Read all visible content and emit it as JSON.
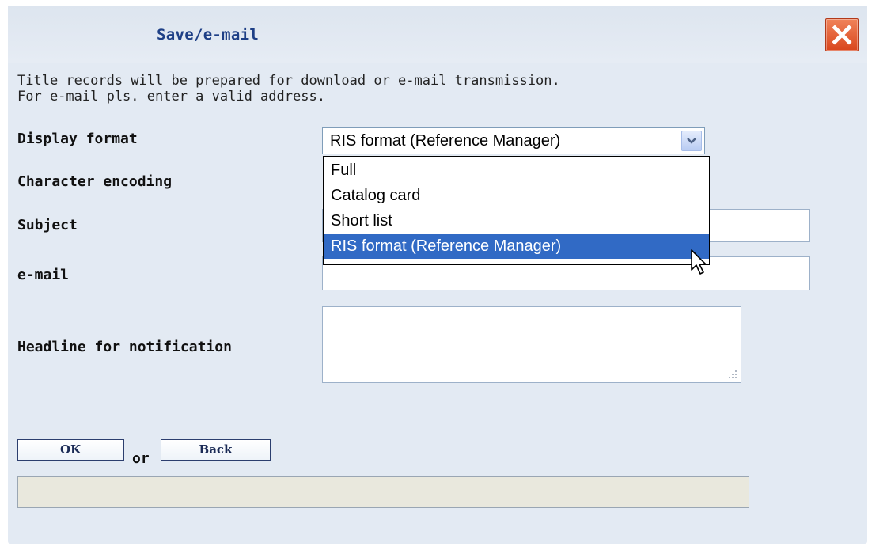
{
  "dialog": {
    "title": "Save/e-mail",
    "close_icon": "close-icon"
  },
  "intro": {
    "line1": "Title records will be prepared for download or e-mail transmission.",
    "line2": "For e-mail pls. enter a valid address."
  },
  "form": {
    "display_format": {
      "label": "Display format",
      "value": "RIS format (Reference Manager)",
      "options": [
        "Full",
        "Catalog card",
        "Short list",
        "RIS format (Reference Manager)"
      ],
      "selected_index": 3
    },
    "character_encoding": {
      "label": "Character encoding"
    },
    "subject": {
      "label": "Subject",
      "value": ""
    },
    "email": {
      "label": "e-mail",
      "value": ""
    },
    "headline": {
      "label": "Headline for notification",
      "value": ""
    }
  },
  "buttons": {
    "ok": "OK",
    "or": "or",
    "back": "Back"
  },
  "status": {
    "text": ""
  },
  "colors": {
    "title": "#1e3f86",
    "close": "#d9461d",
    "selection": "#316ac5",
    "dialog_bg": "#e3eaf3"
  }
}
